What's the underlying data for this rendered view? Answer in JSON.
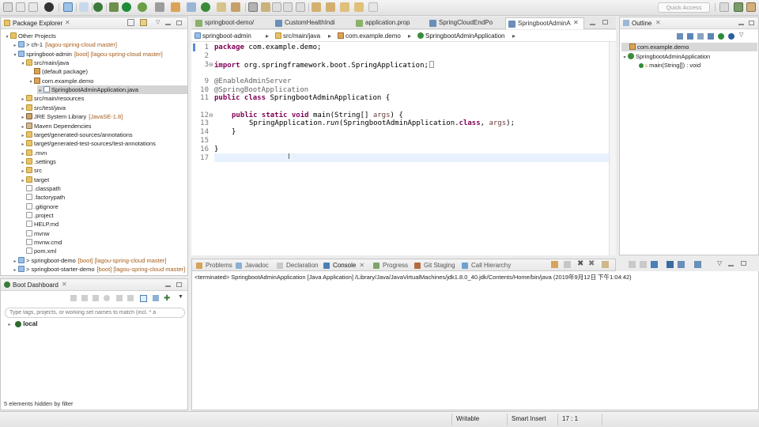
{
  "toolbar": {
    "quick_access_label": "Quick Access"
  },
  "package_explorer": {
    "title": "Package Explorer",
    "tree": [
      {
        "label": "Other Projects",
        "icon": "folder",
        "indent": 0,
        "arrow": "▾"
      },
      {
        "label": "> ch-1",
        "decor": "[lagou-spring-cloud master]",
        "icon": "project",
        "indent": 1,
        "arrow": "▸"
      },
      {
        "label": "springboot-admin",
        "decor": "[boot] [lagou-spring-cloud master]",
        "icon": "project",
        "indent": 1,
        "arrow": "▾"
      },
      {
        "label": "src/main/java",
        "icon": "folder",
        "indent": 2,
        "arrow": "▾"
      },
      {
        "label": "(default package)",
        "icon": "package",
        "indent": 3,
        "arrow": ""
      },
      {
        "label": "com.example.demo",
        "icon": "package",
        "indent": 3,
        "arrow": "▾"
      },
      {
        "label": "SpringbootAdminApplication.java",
        "icon": "java",
        "indent": 4,
        "arrow": "▸",
        "selected": true
      },
      {
        "label": "src/main/resources",
        "icon": "folder",
        "indent": 2,
        "arrow": "▸"
      },
      {
        "label": "src/test/java",
        "icon": "folder",
        "indent": 2,
        "arrow": "▸"
      },
      {
        "label": "JRE System Library",
        "decor": "[JavaSE-1.8]",
        "icon": "jre",
        "indent": 2,
        "arrow": "▸"
      },
      {
        "label": "Maven Dependencies",
        "icon": "library",
        "indent": 2,
        "arrow": "▸"
      },
      {
        "label": "target/generated-sources/annotations",
        "icon": "folder",
        "indent": 2,
        "arrow": "▸"
      },
      {
        "label": "target/generated-test-sources/test-annotations",
        "icon": "folder",
        "indent": 2,
        "arrow": "▸"
      },
      {
        "label": ".mvn",
        "icon": "folder",
        "indent": 2,
        "arrow": "▸"
      },
      {
        "label": ".settings",
        "icon": "folder",
        "indent": 2,
        "arrow": "▸"
      },
      {
        "label": "src",
        "icon": "folder",
        "indent": 2,
        "arrow": "▸"
      },
      {
        "label": "target",
        "icon": "folder",
        "indent": 2,
        "arrow": "▸"
      },
      {
        "label": ".classpath",
        "icon": "file",
        "indent": 2,
        "arrow": ""
      },
      {
        "label": ".factorypath",
        "icon": "file",
        "indent": 2,
        "arrow": ""
      },
      {
        "label": ".gitignore",
        "icon": "file",
        "indent": 2,
        "arrow": ""
      },
      {
        "label": ".project",
        "icon": "file",
        "indent": 2,
        "arrow": ""
      },
      {
        "label": "HELP.md",
        "icon": "file",
        "indent": 2,
        "arrow": ""
      },
      {
        "label": "mvnw",
        "icon": "file",
        "indent": 2,
        "arrow": ""
      },
      {
        "label": "mvnw.cmd",
        "icon": "file",
        "indent": 2,
        "arrow": ""
      },
      {
        "label": "pom.xml",
        "icon": "file",
        "indent": 2,
        "arrow": ""
      },
      {
        "label": "> springboot-demo",
        "decor": "[boot] [lagou-spring-cloud master]",
        "icon": "project",
        "indent": 1,
        "arrow": "▸"
      },
      {
        "label": "> springboot-starter-demo",
        "decor": "[boot] [lagou-spring-cloud master]",
        "icon": "project",
        "indent": 1,
        "arrow": "▸"
      }
    ]
  },
  "boot_dashboard": {
    "title": "Boot Dashboard",
    "filter_placeholder": "Type tags, projects, or working set names to match (incl. * a",
    "local_label": "local",
    "footer": "5 elements hidden by filter"
  },
  "editor": {
    "tabs": [
      {
        "label": "springboot-demo/",
        "icon_color": "#8bb26a"
      },
      {
        "label": "CustomHealthIndi",
        "icon_color": "#6a8fb8"
      },
      {
        "label": "application.prop",
        "icon_color": "#8bb26a"
      },
      {
        "label": "SpringCloudEndPo",
        "icon_color": "#6a8fb8"
      },
      {
        "label": "SpringbootAdminA",
        "icon_color": "#6a8fb8",
        "active": true
      }
    ],
    "breadcrumb": [
      "springboot-admin",
      "src/main/java",
      "com.example.demo",
      "SpringbootAdminApplication"
    ],
    "line_numbers": [
      "1",
      "2",
      "3",
      "9",
      "10",
      "11",
      "12",
      "13",
      "14",
      "15",
      "16",
      "17"
    ],
    "code": {
      "l1_kw": "package",
      "l1_rest": " com.example.demo;",
      "l3_kw": "import",
      "l3_rest": " org.springframework.boot.SpringApplication;",
      "l9": "@EnableAdminServer",
      "l10": "@SpringBootApplication",
      "l11_kw": "public class",
      "l11_rest": " SpringbootAdminApplication {",
      "l13_kw": "public static void",
      "l13_rest": " main(String[] ",
      "l13_var": "args",
      "l13_end": ") {",
      "l14_a": "SpringApplication.",
      "l14_method": "run",
      "l14_b": "(SpringbootAdminApplication.",
      "l14_kw": "class",
      "l14_c": ", ",
      "l14_var": "args",
      "l14_d": ");",
      "l15": "}",
      "l17": "}"
    }
  },
  "outline": {
    "title": "Outline",
    "items": [
      {
        "label": "com.example.demo",
        "selected": true
      },
      {
        "label": "SpringbootAdminApplication"
      },
      {
        "label": "main(String[]) : void",
        "return": " : void"
      }
    ]
  },
  "console": {
    "tabs": [
      "Problems",
      "Javadoc",
      "Declaration",
      "Console",
      "Progress",
      "Git Staging",
      "Call Hierarchy"
    ],
    "active_tab": "Console",
    "output": "<terminated> SpringbootAdminApplication [Java Application] /Library/Java/JavaVirtualMachines/jdk1.8.0_40.jdk/Contents/Home/bin/java (2019年9月12日 下午1:04:42)"
  },
  "statusbar": {
    "writable": "Writable",
    "insert_mode": "Smart Insert",
    "position": "17 : 1"
  }
}
